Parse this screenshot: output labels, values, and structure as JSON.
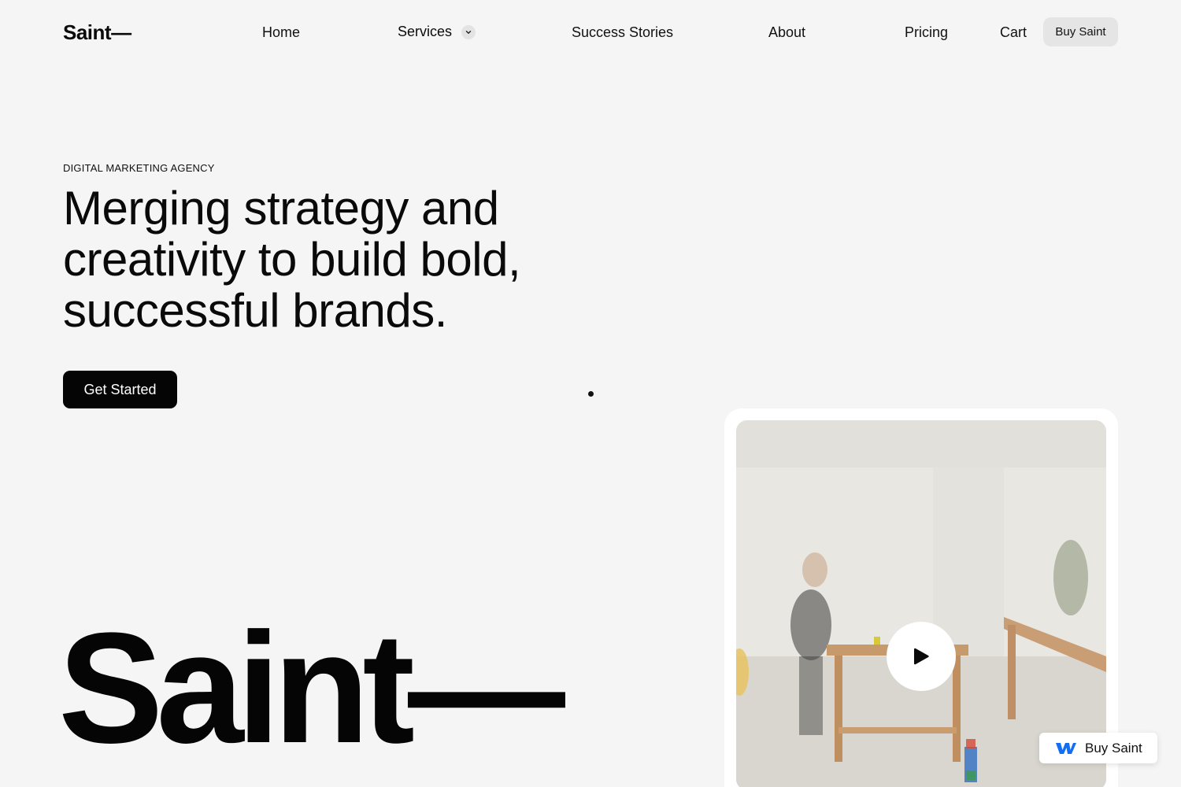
{
  "nav": {
    "logo": "Saint—",
    "links": [
      "Home",
      "Services",
      "Success Stories",
      "About",
      "Pricing",
      "Cart"
    ],
    "buy_label": "Buy Saint"
  },
  "hero": {
    "eyebrow": "DIGITAL MARKETING AGENCY",
    "headline_lines": [
      "Merging strategy and",
      "creativity to build bold,",
      "successful brands."
    ],
    "cta_label": "Get Started",
    "wordmark": "Saint—"
  },
  "video": {
    "play_icon": "play-icon",
    "accent": "#ffffff"
  },
  "badge": {
    "label": "Buy Saint",
    "icon": "webflow-logo-icon",
    "icon_color": "#146ef5"
  },
  "colors": {
    "background": "#f5f5f5",
    "primary_button": "#050505",
    "secondary_button": "#e5e5e5"
  }
}
